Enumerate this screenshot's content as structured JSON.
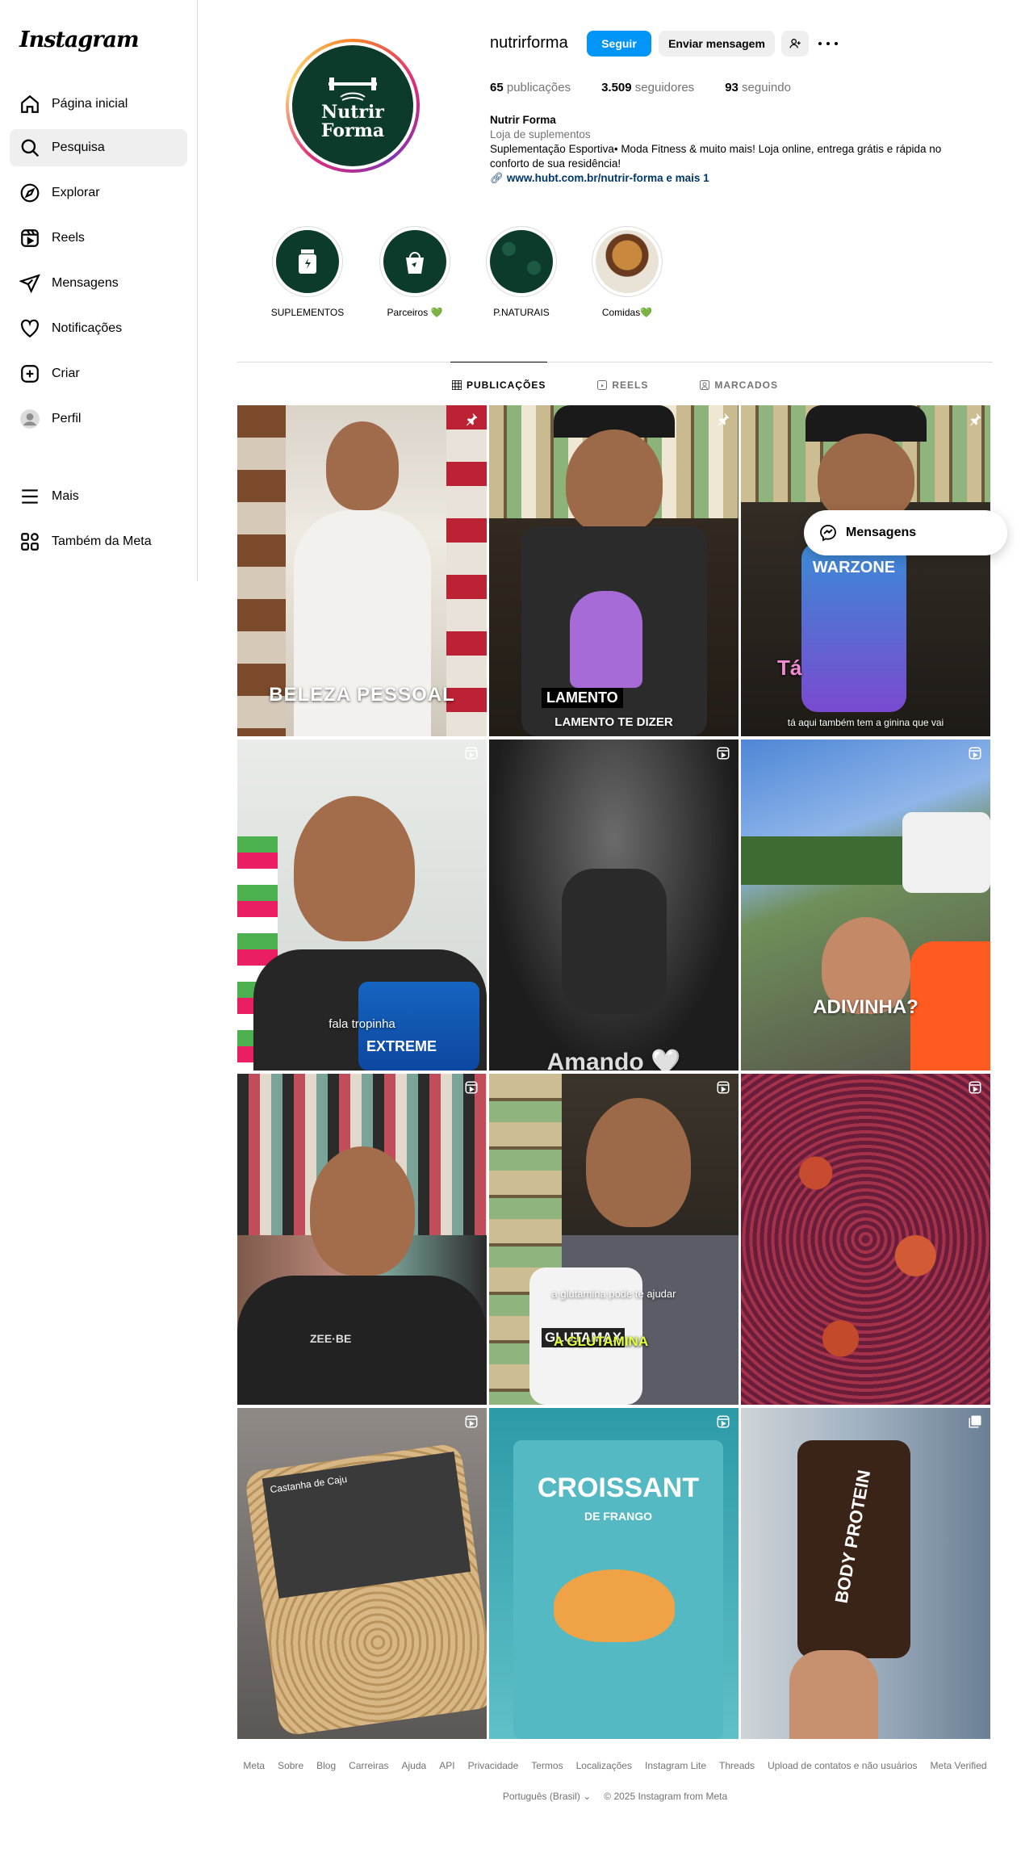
{
  "sidebar": {
    "logo": "Instagram",
    "items": [
      {
        "label": "Página inicial"
      },
      {
        "label": "Pesquisa"
      },
      {
        "label": "Explorar"
      },
      {
        "label": "Reels"
      },
      {
        "label": "Mensagens"
      },
      {
        "label": "Notificações"
      },
      {
        "label": "Criar"
      },
      {
        "label": "Perfil"
      },
      {
        "label": "Mais"
      },
      {
        "label": "Também da Meta"
      }
    ],
    "active_item": "Pesquisa"
  },
  "profile": {
    "username": "nutrirforma",
    "follow_label": "Seguir",
    "message_label": "Enviar mensagem",
    "avatar_text_line1": "Nutrir",
    "avatar_text_line2": "Forma",
    "stats": {
      "posts_count": "65",
      "posts_label": "publicações",
      "followers_count": "3.509",
      "followers_label": "seguidores",
      "following_count": "93",
      "following_label": "seguindo"
    },
    "bio": {
      "name": "Nutrir Forma",
      "category": "Loja de suplementos",
      "text": "Suplementação Esportiva• Moda Fitness & muito mais! Loja online, entrega grátis e rápida no conforto de sua residência!",
      "link": "www.hubt.com.br/nutrir-forma e mais 1"
    }
  },
  "highlights": [
    {
      "label": "SUPLEMENTOS"
    },
    {
      "label": "Parceiros 💚"
    },
    {
      "label": "P.NATURAIS"
    },
    {
      "label": "Comidas💚"
    }
  ],
  "tabs": [
    {
      "label": "PUBLICAÇÕES"
    },
    {
      "label": "REELS"
    },
    {
      "label": "MARCADOS"
    }
  ],
  "posts": [
    {
      "caption": "BELEZA PESSOAL",
      "icon": "pin-icon"
    },
    {
      "caption": "LAMENTO",
      "caption2": "LAMENTO TE DIZER",
      "icon": "pin-icon"
    },
    {
      "caption": "Tá",
      "caption2": "tá aqui também tem a ginina que vai",
      "overlay": "WARZONE",
      "icon": "pin-icon"
    },
    {
      "caption": "fala tropinha",
      "overlay": "EXTREME",
      "icon": "reels-icon"
    },
    {
      "caption": "Amando 🤍",
      "icon": "reels-icon"
    },
    {
      "caption": "ADIVINHA?",
      "icon": "reels-icon"
    },
    {
      "caption": "",
      "icon": "reels-icon",
      "overlay": "ZEE·BE"
    },
    {
      "caption": "a glutamina pode te ajudar",
      "caption2": "A GLUTAMINA",
      "overlay": "GLUTAMAX",
      "icon": "reels-icon"
    },
    {
      "caption": "",
      "icon": "reels-icon"
    },
    {
      "caption": "",
      "overlay": "Castanha de Caju",
      "icon": "reels-icon"
    },
    {
      "caption": "",
      "overlay": "CROISSANT",
      "overlay2": "DE FRANGO",
      "icon": "reels-icon"
    },
    {
      "caption": "",
      "overlay": "BODY PROTEIN",
      "icon": "carousel-icon"
    }
  ],
  "messages_button": "Mensagens",
  "footer": {
    "links": [
      "Meta",
      "Sobre",
      "Blog",
      "Carreiras",
      "Ajuda",
      "API",
      "Privacidade",
      "Termos",
      "Localizações",
      "Instagram Lite",
      "Threads",
      "Upload de contatos e não usuários",
      "Meta Verified"
    ],
    "language": "Português (Brasil)",
    "copyright": "© 2025 Instagram from Meta"
  }
}
